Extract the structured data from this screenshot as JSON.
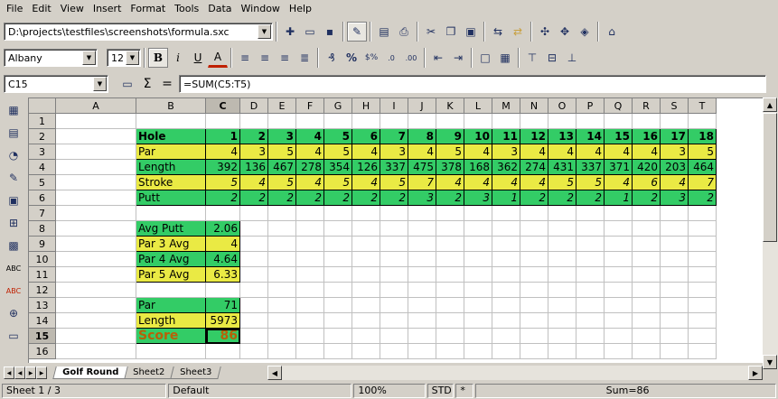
{
  "menu": [
    "File",
    "Edit",
    "View",
    "Insert",
    "Format",
    "Tools",
    "Data",
    "Window",
    "Help"
  ],
  "toolbar": {
    "path": "D:\\projects\\testfiles\\screenshots\\formula.sxc",
    "icons": [
      "new-icon",
      "open-icon",
      "save-icon",
      "edit-file-icon",
      "export-pdf-icon",
      "print-icon",
      "cut-icon",
      "copy-icon",
      "paste-icon",
      "undo-icon",
      "redo-icon",
      "navigator-icon",
      "stylist-icon",
      "gallery-icon",
      "hyperlink-icon"
    ]
  },
  "format": {
    "font": "Albany",
    "size": "12",
    "bold": "B",
    "italic": "i",
    "underline": "U",
    "font_color": "A"
  },
  "formula_bar": {
    "cell_ref": "C15",
    "sum": "Σ",
    "equals": "=",
    "formula": "=SUM(C5:T5)"
  },
  "columns": [
    "A",
    "B",
    "C",
    "D",
    "E",
    "F",
    "G",
    "H",
    "I",
    "J",
    "K",
    "L",
    "M",
    "N",
    "O",
    "P",
    "Q",
    "R",
    "S",
    "T"
  ],
  "rows": [
    "1",
    "2",
    "3",
    "4",
    "5",
    "6",
    "7",
    "8",
    "9",
    "10",
    "11",
    "12",
    "13",
    "14",
    "15",
    "16"
  ],
  "table": {
    "hole": {
      "label": "Hole",
      "values": [
        "1",
        "2",
        "3",
        "4",
        "5",
        "6",
        "7",
        "8",
        "9",
        "10",
        "11",
        "12",
        "13",
        "14",
        "15",
        "16",
        "17",
        "18"
      ]
    },
    "par": {
      "label": "Par",
      "values": [
        "4",
        "3",
        "5",
        "4",
        "5",
        "4",
        "3",
        "4",
        "5",
        "4",
        "3",
        "4",
        "4",
        "4",
        "4",
        "4",
        "3",
        "5"
      ]
    },
    "length": {
      "label": "Length",
      "values": [
        "392",
        "136",
        "467",
        "278",
        "354",
        "126",
        "337",
        "475",
        "378",
        "168",
        "362",
        "274",
        "431",
        "337",
        "371",
        "420",
        "203",
        "464"
      ]
    },
    "stroke": {
      "label": "Stroke",
      "values": [
        "5",
        "4",
        "5",
        "4",
        "5",
        "4",
        "5",
        "7",
        "4",
        "4",
        "4",
        "4",
        "5",
        "5",
        "4",
        "6",
        "4",
        "7"
      ]
    },
    "putt": {
      "label": "Putt",
      "values": [
        "2",
        "2",
        "2",
        "2",
        "2",
        "2",
        "2",
        "3",
        "2",
        "3",
        "1",
        "2",
        "2",
        "2",
        "1",
        "2",
        "3",
        "2"
      ]
    }
  },
  "stats": [
    {
      "label": "Avg Putt",
      "value": "2.06"
    },
    {
      "label": "Par 3 Avg",
      "value": "4"
    },
    {
      "label": "Par 4 Avg",
      "value": "4.64"
    },
    {
      "label": "Par 5 Avg",
      "value": "6.33"
    }
  ],
  "totals": [
    {
      "label": "Par",
      "value": "71"
    },
    {
      "label": "Length",
      "value": "5973"
    },
    {
      "label": "Score",
      "value": "86"
    }
  ],
  "tabs": [
    "Golf Round",
    "Sheet2",
    "Sheet3"
  ],
  "status": {
    "sheet": "Sheet 1 / 3",
    "style": "Default",
    "zoom": "100%",
    "mode": "STD",
    "modified": "*",
    "sum": "Sum=86"
  },
  "colors": {
    "green": "#33cc66",
    "yellow": "#eaea44",
    "score": "#b86008",
    "chrome": "#d4d0c8"
  }
}
